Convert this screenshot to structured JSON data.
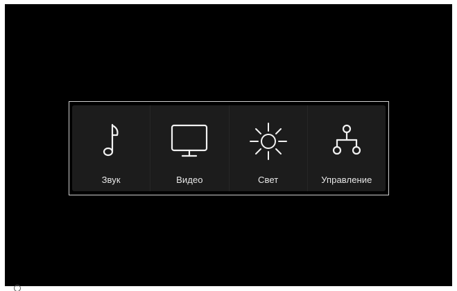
{
  "menu": {
    "items": [
      {
        "id": "sound",
        "label": "Звук",
        "icon": "music-note-icon"
      },
      {
        "id": "video",
        "label": "Видео",
        "icon": "monitor-icon"
      },
      {
        "id": "light",
        "label": "Свет",
        "icon": "sun-icon"
      },
      {
        "id": "control",
        "label": "Управление",
        "icon": "hierarchy-icon"
      }
    ]
  },
  "colors": {
    "background": "#000000",
    "panel": "#1c1c1c",
    "frame": "#cfcfcf",
    "icon": "#f2f2f2",
    "text": "#e8e8e8"
  }
}
